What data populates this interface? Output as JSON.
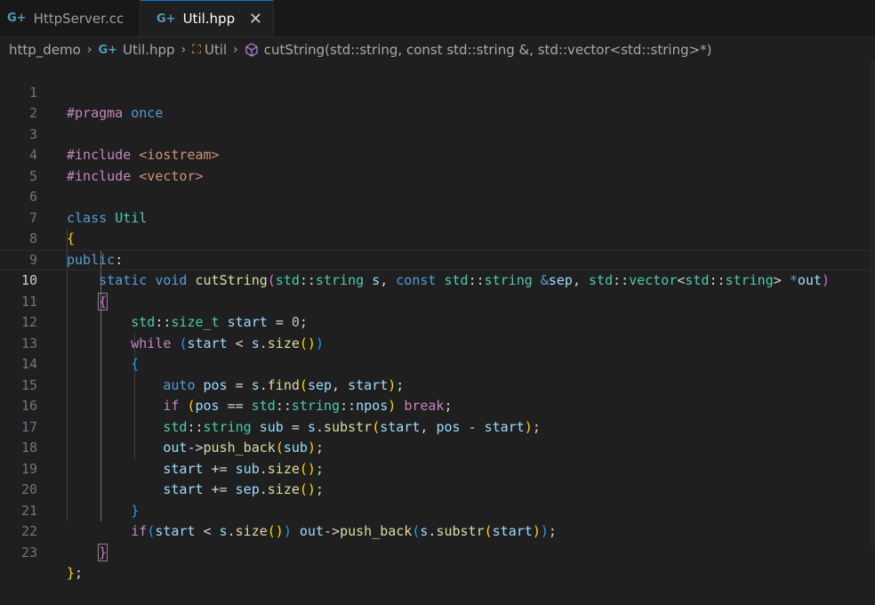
{
  "tabs": [
    {
      "label": "HttpServer.cc",
      "icon": "cpp-file-icon",
      "active": false
    },
    {
      "label": "Util.hpp",
      "icon": "cpp-header-icon",
      "active": true
    }
  ],
  "breadcrumb": {
    "folder": "http_demo",
    "file": "Util.hpp",
    "class": "Util",
    "symbol": "cutString(std::string, const std::string &, std::vector<std::string>*)"
  },
  "editor": {
    "current_line": 10,
    "line_numbers": [
      "1",
      "2",
      "3",
      "4",
      "5",
      "6",
      "7",
      "8",
      "9",
      "10",
      "11",
      "12",
      "13",
      "14",
      "15",
      "16",
      "17",
      "18",
      "19",
      "20",
      "21",
      "22",
      "23"
    ],
    "lines": [
      "#pragma once",
      "",
      "#include <iostream>",
      "#include <vector>",
      "",
      "class Util",
      "{",
      "public:",
      "    static void cutString(std::string s, const std::string &sep, std::vector<std::string> *out)",
      "    {",
      "        std::size_t start = 0;",
      "        while (start < s.size())",
      "        {",
      "            auto pos = s.find(sep, start);",
      "            if (pos == std::string::npos) break;",
      "            std::string sub = s.substr(start, pos - start);",
      "            out->push_back(sub);",
      "            start += sub.size();",
      "            start += sep.size();",
      "        }",
      "        if(start < s.size()) out->push_back(s.substr(start));",
      "    }",
      "};"
    ]
  },
  "colors": {
    "background": "#1f1f1f",
    "keyword": "#569cd6",
    "control": "#c586c0",
    "function": "#dcdcaa",
    "type": "#4ec9b0",
    "variable": "#9cdcfe",
    "number": "#b5cea8"
  }
}
